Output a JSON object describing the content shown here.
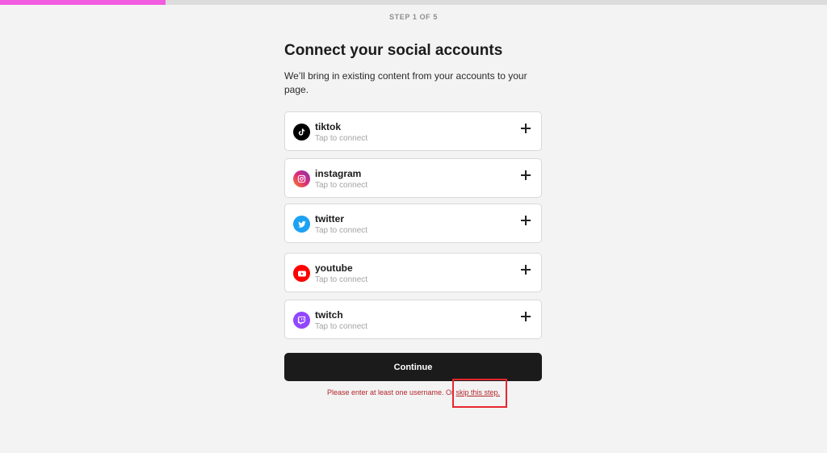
{
  "progress": {
    "step_text": "STEP 1 OF 5",
    "fraction": 0.2,
    "color": "#f25cdf"
  },
  "header": {
    "title": "Connect your social accounts",
    "subtitle": "We’ll bring in existing content from your accounts to your page."
  },
  "accounts": [
    {
      "name": "tiktok",
      "hint": "Tap to connect",
      "icon": "tiktok-icon",
      "color": "#000000"
    },
    {
      "name": "instagram",
      "hint": "Tap to connect",
      "icon": "instagram-icon",
      "color": "#c13584"
    },
    {
      "name": "twitter",
      "hint": "Tap to connect",
      "icon": "twitter-icon",
      "color": "#1da1f2"
    },
    {
      "name": "youtube",
      "hint": "Tap to connect",
      "icon": "youtube-icon",
      "color": "#ff0000"
    },
    {
      "name": "twitch",
      "hint": "Tap to connect",
      "icon": "twitch-icon",
      "color": "#9146ff"
    }
  ],
  "actions": {
    "continue_label": "Continue",
    "error_text": "Please enter at least one username. Or ",
    "skip_label": "skip this step."
  }
}
